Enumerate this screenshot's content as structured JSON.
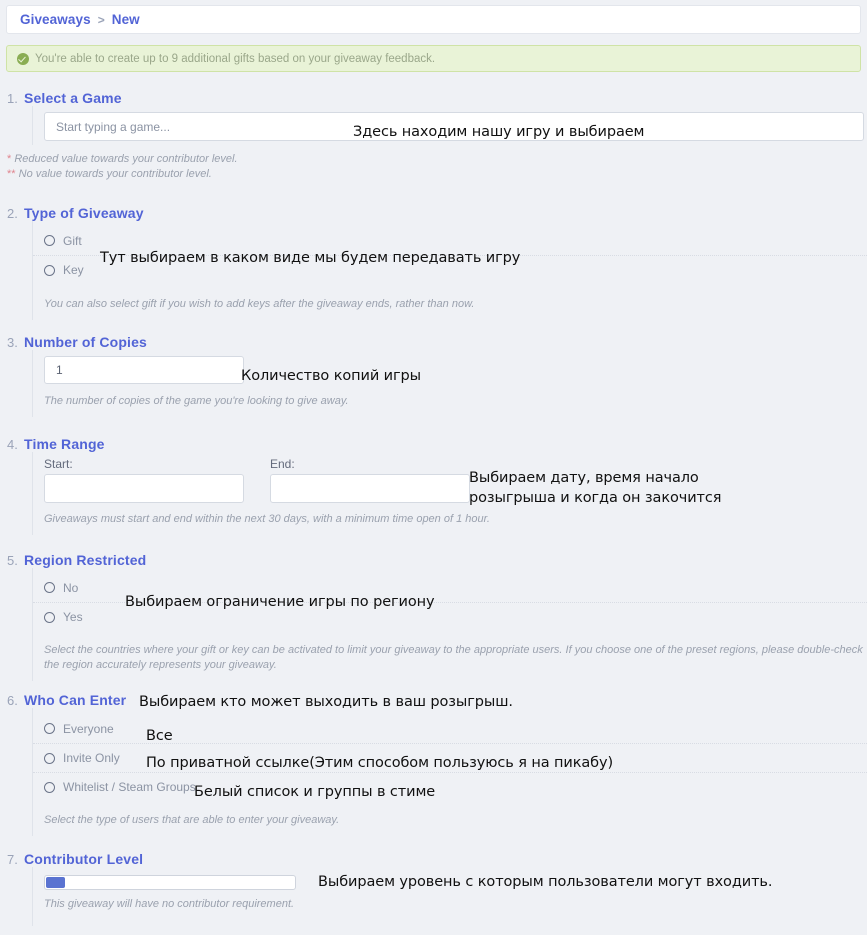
{
  "breadcrumb": {
    "root": "Giveaways",
    "separator": ">",
    "current": "New"
  },
  "alert": {
    "text": "You're able to create up to 9 additional gifts based on your giveaway feedback."
  },
  "sections": [
    {
      "number": "1.",
      "title": "Select a Game",
      "placeholder": "Start typing a game...",
      "footnote_1": "Reduced value towards your contributor level.",
      "footnote_2": "No value towards your contributor level.",
      "star_1": "*",
      "star_2": "**"
    },
    {
      "number": "2.",
      "title": "Type of Giveaway",
      "options": [
        "Gift",
        "Key"
      ],
      "note": "You can also select gift if you wish to add keys after the giveaway ends, rather than now."
    },
    {
      "number": "3.",
      "title": "Number of Copies",
      "value": "1",
      "note": "The number of copies of the game you're looking to give away."
    },
    {
      "number": "4.",
      "title": "Time Range",
      "start_label": "Start:",
      "end_label": "End:",
      "start_value": "",
      "end_value": "",
      "note": "Giveaways must start and end within the next 30 days, with a minimum time open of 1 hour."
    },
    {
      "number": "5.",
      "title": "Region Restricted",
      "options": [
        "No",
        "Yes"
      ],
      "note": "Select the countries where your gift or key can be activated to limit your giveaway to the appropriate users. If you choose one of the preset regions, please double-check the region accurately represents your giveaway."
    },
    {
      "number": "6.",
      "title": "Who Can Enter",
      "options": [
        "Everyone",
        "Invite Only",
        "Whitelist / Steam Groups"
      ],
      "note": "Select the type of users that are able to enter your giveaway."
    },
    {
      "number": "7.",
      "title": "Contributor Level",
      "note": "This giveaway will have no contributor requirement."
    }
  ],
  "annotations": {
    "select_game": "Здесь находим нашу игру и выбираем",
    "type_of_giveaway": "Тут выбираем в каком виде мы будем передавать игру",
    "number_of_copies": "Количество копий игры",
    "time_range": "Выбираем дату, время начало\nрозыгрыша и когда он закочится",
    "region_restricted": "Выбираем ограничение игры по региону",
    "who_can_enter": "Выбираем кто может выходить в ваш розыгрыш.",
    "everyone": "Все",
    "invite_only": "По приватной ссылке(Этим способом пользуюсь я на пикабу)",
    "whitelist": "Белый список и группы в стиме",
    "contributor_level": "Выбираем уровень с которым пользователи могут входить."
  },
  "colors": {
    "accent": "#5264d6",
    "slider_handle": "#5a73d1",
    "alert_bg": "#e9f3d7",
    "page_bg": "#eff1f5"
  }
}
